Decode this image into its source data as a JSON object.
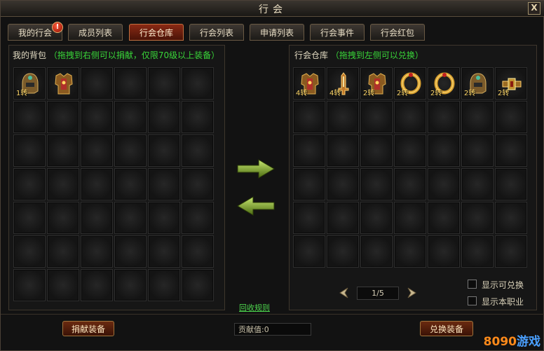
{
  "window": {
    "title": "行会",
    "close_label": "X"
  },
  "tabs": [
    {
      "label": "我的行会",
      "active": false,
      "alert": true
    },
    {
      "label": "成员列表",
      "active": false
    },
    {
      "label": "行会仓库",
      "active": true
    },
    {
      "label": "行会列表",
      "active": false
    },
    {
      "label": "申请列表",
      "active": false
    },
    {
      "label": "行会事件",
      "active": false
    },
    {
      "label": "行会红包",
      "active": false
    }
  ],
  "alert_symbol": "!",
  "left_panel": {
    "title": "我的背包",
    "hint": "（拖拽到右侧可以捐献，仅限70级以上装备）",
    "items": [
      {
        "rank": "1转",
        "icon": "helmet-icon"
      },
      {
        "rank": "",
        "icon": "armor-icon"
      }
    ]
  },
  "right_panel": {
    "title": "行会仓库",
    "hint": "（拖拽到左侧可以兑换）",
    "items": [
      {
        "rank": "4转",
        "icon": "armor-icon"
      },
      {
        "rank": "4转",
        "icon": "sword-icon"
      },
      {
        "rank": "2转",
        "icon": "armor-icon"
      },
      {
        "rank": "2转",
        "icon": "bracelet-icon"
      },
      {
        "rank": "2转",
        "icon": "bracelet-icon"
      },
      {
        "rank": "2转",
        "icon": "helmet-icon"
      },
      {
        "rank": "2转",
        "icon": "belt-icon"
      }
    ]
  },
  "pager": {
    "text": "1/5"
  },
  "options": [
    {
      "label": "显示可兑换"
    },
    {
      "label": "显示本职业"
    }
  ],
  "recycle_rule": "回收规则",
  "contribution": "贡献值:0",
  "donate_button": "捐献装备",
  "exchange_button": "兑换装备",
  "watermark": {
    "num": "8090",
    "text": "游戏"
  },
  "colors": {
    "accent_green": "#39d639",
    "gold": "#ffd86a",
    "active_tab": "#8a2a14"
  }
}
